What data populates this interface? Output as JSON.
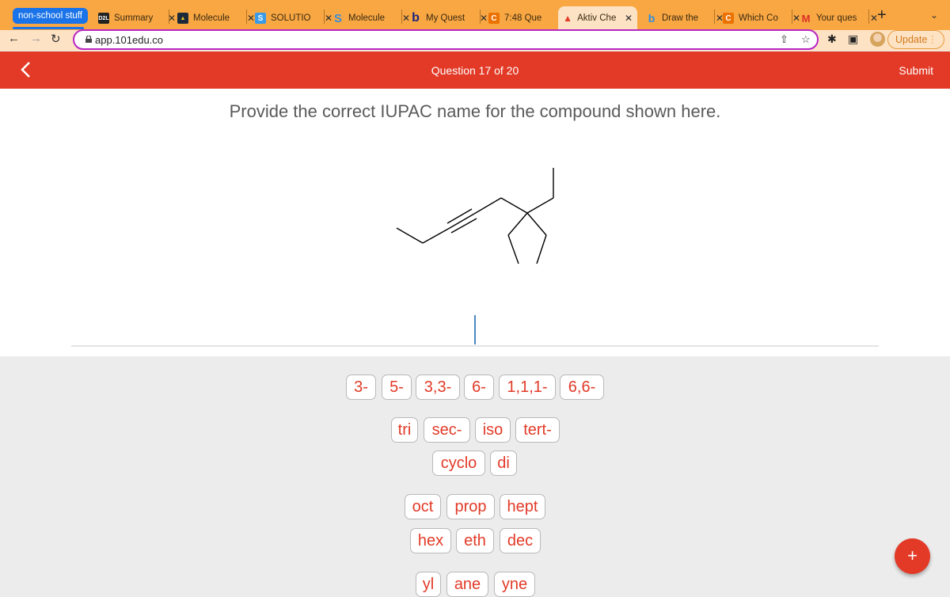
{
  "browser": {
    "tab_group": "non-school stuff",
    "tabs": [
      {
        "title": "Summary",
        "icon": "d2l-favicon",
        "active": false
      },
      {
        "title": "Molecule",
        "icon": "phet-favicon",
        "active": false
      },
      {
        "title": "SOLUTIO",
        "icon": "s-app-favicon",
        "active": false
      },
      {
        "title": "Molecule",
        "icon": "s-letter-favicon",
        "active": false
      },
      {
        "title": "My Quest",
        "icon": "bartleby-favicon",
        "active": false
      },
      {
        "title": "7:48 Que",
        "icon": "chegg-favicon",
        "active": false
      },
      {
        "title": "Aktiv Che",
        "icon": "aktiv-favicon",
        "active": true
      },
      {
        "title": "Draw the",
        "icon": "bing-favicon",
        "active": false
      },
      {
        "title": "Which Co",
        "icon": "chegg-favicon",
        "active": false
      },
      {
        "title": "Your ques",
        "icon": "gmail-favicon",
        "active": false
      }
    ],
    "url": "app.101edu.co",
    "update_label": "Update"
  },
  "app": {
    "question_counter": "Question 17 of 20",
    "submit_label": "Submit",
    "prompt": "Provide the correct IUPAC name for the compound shown here.",
    "answer_value": "",
    "keyboard": {
      "row1": [
        "3-",
        "5-",
        "3,3-",
        "6-",
        "1,1,1-",
        "6,6-"
      ],
      "row2": [
        "tri",
        "sec-",
        "iso",
        "tert-"
      ],
      "row3": [
        "cyclo",
        "di"
      ],
      "row4": [
        "oct",
        "prop",
        "hept"
      ],
      "row5": [
        "hex",
        "eth",
        "dec"
      ],
      "row6": [
        "yl",
        "ane",
        "yne"
      ]
    },
    "fab_label": "+"
  },
  "colors": {
    "brand_red": "#e23a27",
    "tab_orange": "#f9a743",
    "group_blue": "#1a73e8"
  }
}
